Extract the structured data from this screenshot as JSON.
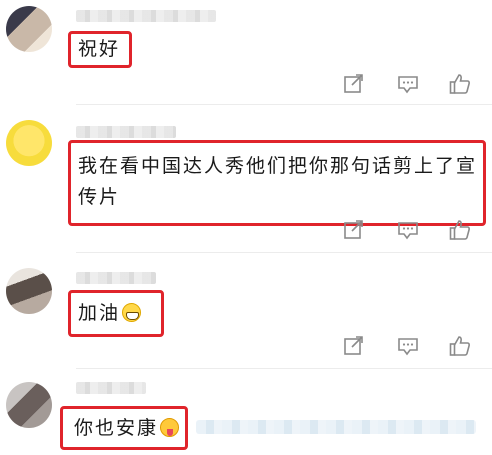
{
  "comments": [
    {
      "text": "祝好",
      "emoji": ""
    },
    {
      "text": "我在看中国达人秀他们把你那句话剪上了宣",
      "text2": "传片",
      "emoji": ""
    },
    {
      "text": "加油",
      "emoji": "grinning-face"
    },
    {
      "text": "你也安康",
      "emoji": "face-with-tongue"
    }
  ],
  "colors": {
    "highlight_border": "#e0242b",
    "icon_stroke": "#8a8a8a",
    "text": "#1a1a1a"
  },
  "icons": [
    "share-icon",
    "comment-icon",
    "like-icon"
  ]
}
